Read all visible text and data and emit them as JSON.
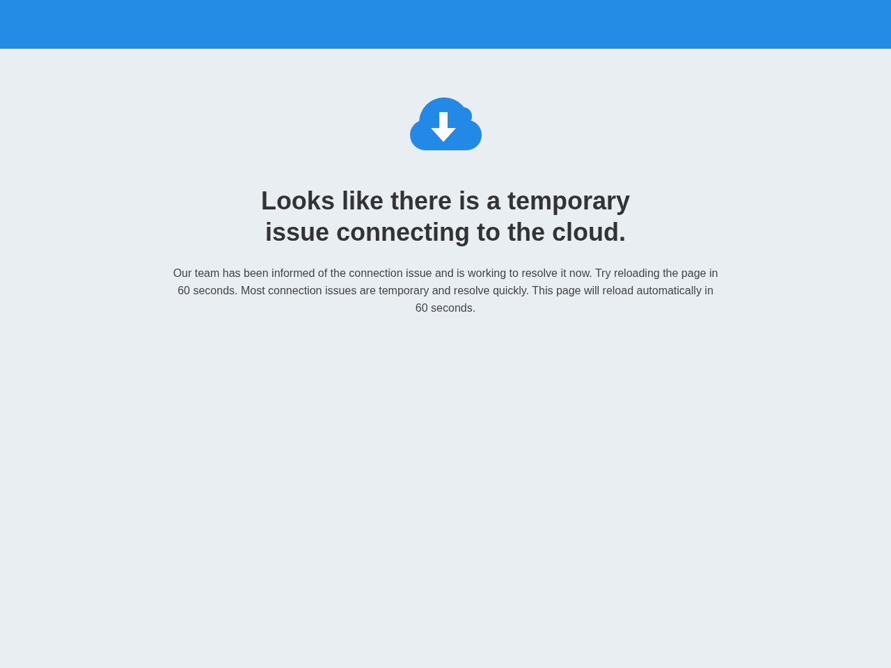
{
  "message": {
    "title": "Looks like there is a temporary issue connecting to the cloud.",
    "body": "Our team has been informed of the connection issue and is working to resolve it now. Try reloading the page in 60 seconds. Most connection issues are temporary and resolve quickly. This page will reload automatically in 60 seconds."
  }
}
